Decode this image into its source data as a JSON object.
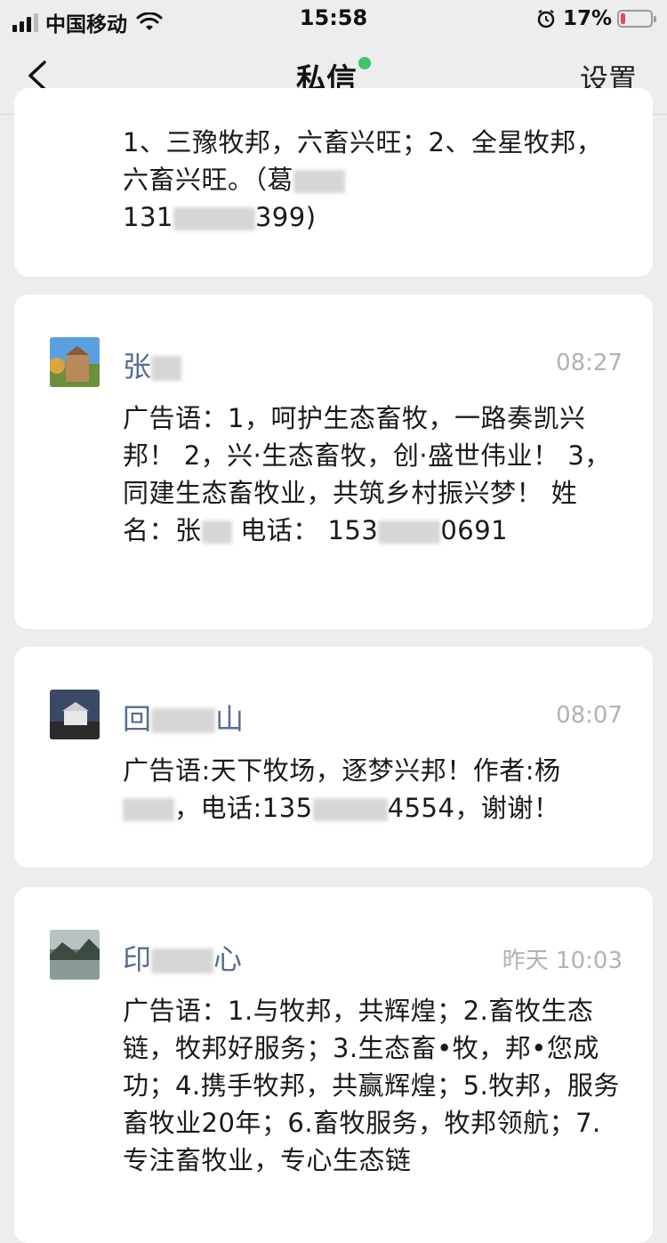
{
  "status_bar": {
    "carrier": "中国移动",
    "time": "15:58",
    "battery": "17%",
    "battery_level": 0.17
  },
  "nav": {
    "title": "私信",
    "settings": "设置",
    "online_color": "#3fc46b"
  },
  "colors": {
    "sender_name": "#576b95",
    "timestamp": "#b2b2b2"
  },
  "messages": [
    {
      "text_parts": [
        "1、三豫牧邦，六畜兴旺；2、全星牧邦，六畜兴旺。（葛",
        "131",
        "399)"
      ]
    },
    {
      "sender": "张",
      "time": "08:27",
      "text_parts": [
        "广告语：1，呵护生态畜牧，一路奏凯兴邦！ 2，兴·生态畜牧，创·盛世伟业！ 3，同建生态畜牧业，共筑乡村振兴梦！ 姓名：张",
        "电话：",
        "153",
        "0691"
      ]
    },
    {
      "sender_parts": [
        "回",
        "山"
      ],
      "time": "08:07",
      "text_parts": [
        "广告语:天下牧场，逐梦兴邦！作者:杨",
        "，电话:135",
        "4554，谢谢！"
      ]
    },
    {
      "sender_parts": [
        "印",
        "心"
      ],
      "time": "昨天 10:03",
      "text_parts": [
        "广告语：1.与牧邦，共辉煌；2.畜牧生态链，牧邦好服务；3.生态畜•牧，邦•您成功；4.携手牧邦，共赢辉煌；5.牧邦，服务畜牧业20年；6.畜牧服务，牧邦领航；7.专注畜牧业，专心生态链"
      ]
    }
  ]
}
